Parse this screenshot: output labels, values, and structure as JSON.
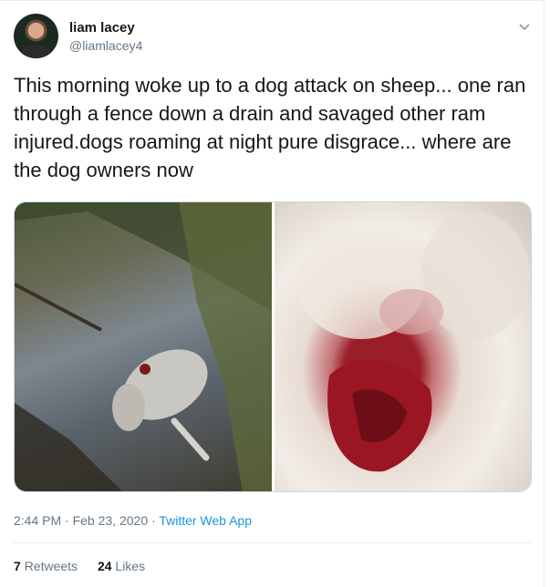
{
  "user": {
    "display_name": "liam lacey",
    "handle": "@liamlacey4",
    "avatar_icon": "profile-photo"
  },
  "tweet": {
    "text": "This morning woke up to a dog attack on sheep... one ran through a fence down a drain and savaged other ram injured.dogs roaming at night pure disgrace... where are the dog owners now"
  },
  "meta": {
    "time": "2:44 PM",
    "sep1": " · ",
    "date": "Feb 23, 2020",
    "sep2": " · ",
    "source": "Twitter Web App"
  },
  "stats": {
    "retweets_count": "7",
    "retweets_label": "Retweets",
    "likes_count": "24",
    "likes_label": "Likes"
  },
  "colors": {
    "link": "#1b95e0",
    "muted": "#657786",
    "text": "#14171a"
  }
}
